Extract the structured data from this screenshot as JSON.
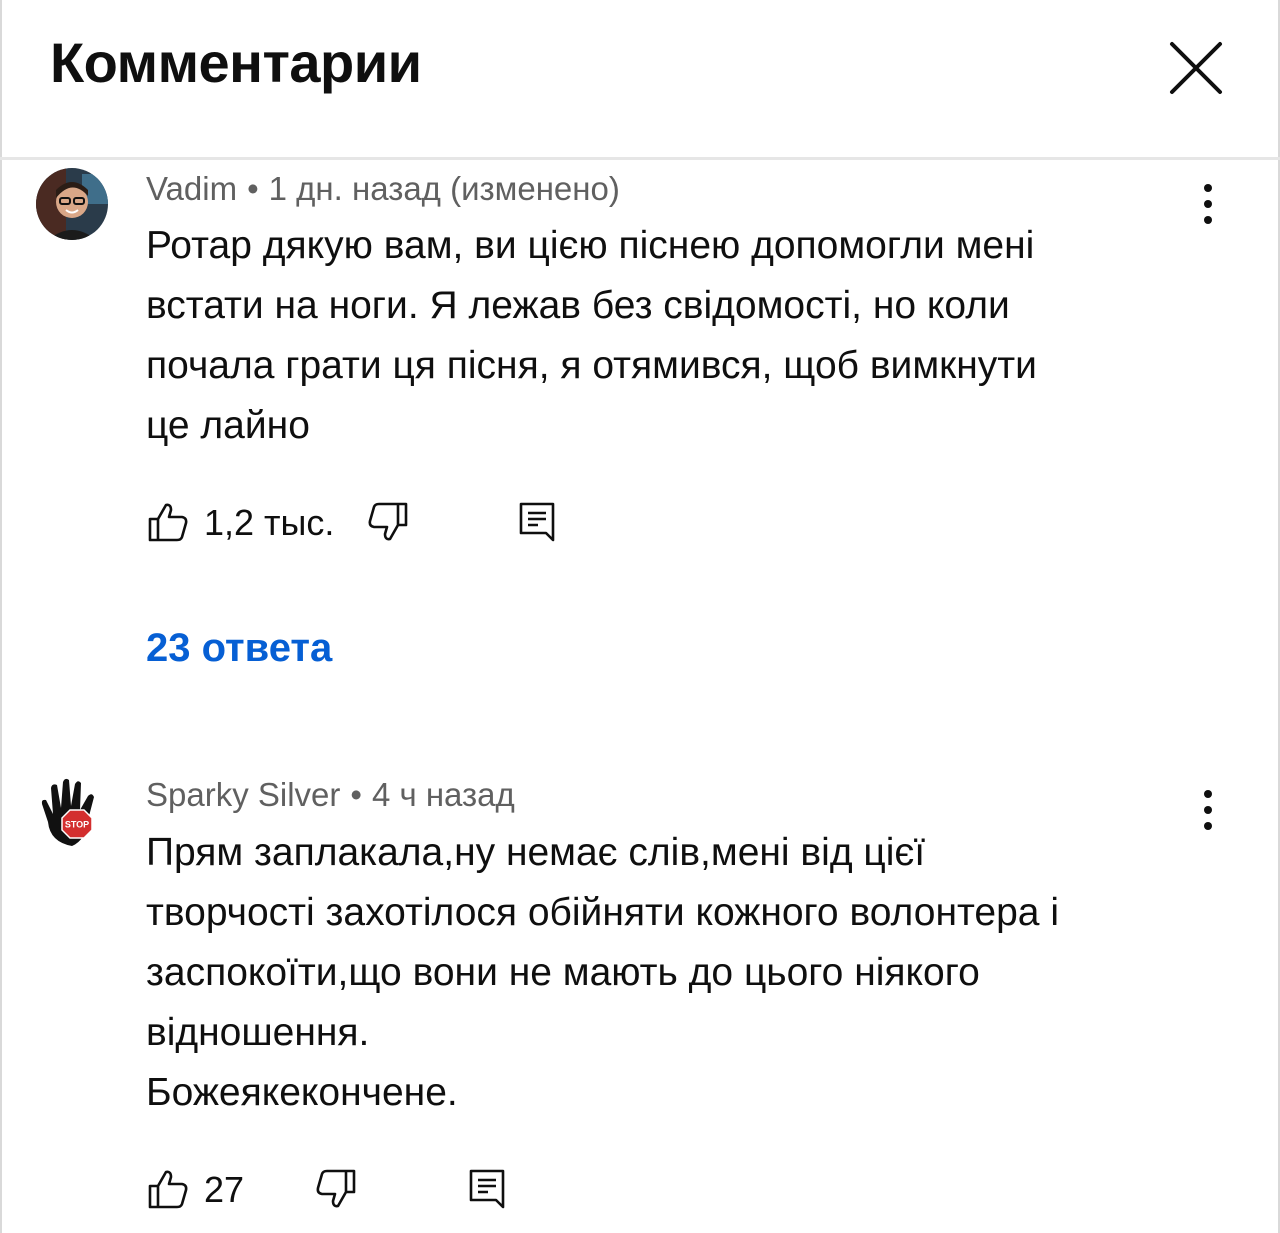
{
  "header": {
    "title": "Комментарии"
  },
  "comments": [
    {
      "author": "Vadim",
      "time": "1 дн. назад (изменено)",
      "text_lines": [
        "Ротар дякую вам, ви цією піснею допомогли мені",
        "встати на ноги. Я лежав без свідомості, но коли",
        "почала грати ця пісня, я отямився, щоб вимкнути",
        "це лайно"
      ],
      "likes": "1,2 тыс.",
      "replies": "23 ответа"
    },
    {
      "author": "Sparky Silver",
      "time": "4 ч назад",
      "text_lines": [
        "Прям заплакала,ну немає слів,мені від цієї",
        "творчості захотілося обійняти кожного волонтера і",
        "заспокоїти,що вони не мають до цього ніякого",
        "відношення.",
        "Божеякекончене."
      ],
      "likes": "27",
      "avatar_stamp": "STOP"
    }
  ],
  "separator": "•",
  "icons": {
    "close": "close-icon",
    "more": "more-vert-icon",
    "like": "thumb-up-icon",
    "dislike": "thumb-down-icon",
    "reply": "reply-comment-icon"
  },
  "colors": {
    "link": "#065fd4",
    "meta": "#606060",
    "text": "#0f0f0f"
  }
}
